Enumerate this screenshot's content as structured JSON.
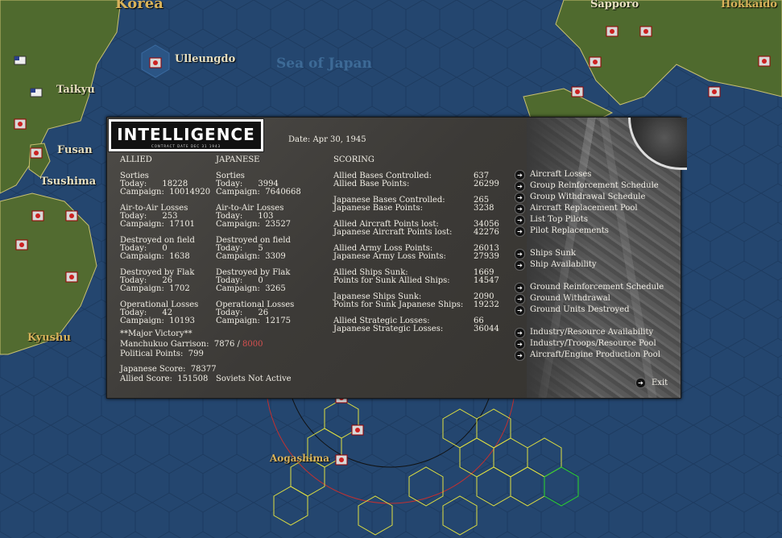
{
  "map": {
    "places": {
      "korea": "Korea",
      "ulleungdo": "Ulleungdo",
      "sea_of_japan": "Sea of Japan",
      "sapporo": "Sapporo",
      "hokkaido": "Hokkaido",
      "taikyu": "Taikyu",
      "fusan": "Fusan",
      "tsushima": "Tsushima",
      "kyushu": "Kyushu",
      "aogashima": "Aogashima"
    }
  },
  "panel": {
    "logo_title": "INTELLIGENCE",
    "logo_sub": "CONTRACT DATE DEC 31 1943",
    "date": "Date: Apr 30, 1945",
    "allied": {
      "header": "ALLIED",
      "sorties": [
        "Sorties",
        "Today:      18228",
        "Campaign:  10014920"
      ],
      "a2a": [
        "Air-to-Air Losses",
        "Today:      253",
        "Campaign:  17101"
      ],
      "field": [
        "Destroyed on field",
        "Today:      0",
        "Campaign:  1638"
      ],
      "flak": [
        "Destroyed by Flak",
        "Today:      26",
        "Campaign:  1702"
      ],
      "ops": [
        "Operational Losses",
        "Today:      42",
        "Campaign:  10193"
      ]
    },
    "japanese": {
      "header": "JAPANESE",
      "sorties": [
        "Sorties",
        "Today:      3994",
        "Campaign:  7640668"
      ],
      "a2a": [
        "Air-to-Air Losses",
        "Today:      103",
        "Campaign:  23527"
      ],
      "field": [
        "Destroyed on field",
        "Today:      5",
        "Campaign:  3309"
      ],
      "flak": [
        "Destroyed by Flak",
        "Today:      0",
        "Campaign:  3265"
      ],
      "ops": [
        "Operational Losses",
        "Today:      26",
        "Campaign:  12175"
      ]
    },
    "victory": "**Major Victory**",
    "garrison_label": "Manchukuo Garrison:  7876 / ",
    "garrison_required": "8000",
    "political": "Political Points:  799",
    "japanese_score": "Japanese Score:  78377",
    "allied_score": "Allied Score:  151508",
    "soviets": "Soviets Not Active",
    "scoring": {
      "header": "SCORING",
      "groups": [
        [
          [
            "Allied Bases Controlled:",
            "637"
          ],
          [
            "Allied Base Points:",
            "26299"
          ]
        ],
        [
          [
            "Japanese Bases Controlled:",
            "265"
          ],
          [
            "Japanese Base Points:",
            "3238"
          ]
        ],
        [
          [
            "Allied Aircraft Points lost:",
            "34056"
          ],
          [
            "Japanese Aircraft Points lost:",
            "42276"
          ]
        ],
        [
          [
            "Allied Army Loss Points:",
            "26013"
          ],
          [
            "Japanese Army Loss Points:",
            "27939"
          ]
        ],
        [
          [
            "Allied Ships Sunk:",
            "1669"
          ],
          [
            "Points for Sunk Allied Ships:",
            "14547"
          ]
        ],
        [
          [
            "Japanese Ships Sunk:",
            "2090"
          ],
          [
            "Points for Sunk Japanese Ships:",
            "19232"
          ]
        ],
        [
          [
            "Allied Strategic Losses:",
            "66"
          ],
          [
            "Japanese Strategic Losses:",
            "36044"
          ]
        ]
      ]
    },
    "links": {
      "aircraft_losses": "Aircraft Losses",
      "group_reinforcement": "Group Reinforcement Schedule",
      "group_withdrawal": "Group Withdrawal Schedule",
      "aircraft_replacement": "Aircraft Replacement Pool",
      "top_pilots": "List Top Pilots",
      "pilot_replacements": "Pilot Replacements",
      "ships_sunk": "Ships Sunk",
      "ship_availability": "Ship Availability",
      "ground_reinforcement": "Ground Reinforcement Schedule",
      "ground_withdrawal": "Ground Withdrawal",
      "ground_destroyed": "Ground Units Destroyed",
      "industry_availability": "Industry/Resource Availability",
      "industry_pool": "Industry/Troops/Resource Pool",
      "engine_pool": "Aircraft/Engine Production Pool",
      "exit": "Exit"
    },
    "colors": {
      "accent_red": "#d85050",
      "panel_bg": "#42403c",
      "text": "#f2efe6"
    },
    "icons": {
      "link": "right-arrow-icon"
    }
  }
}
